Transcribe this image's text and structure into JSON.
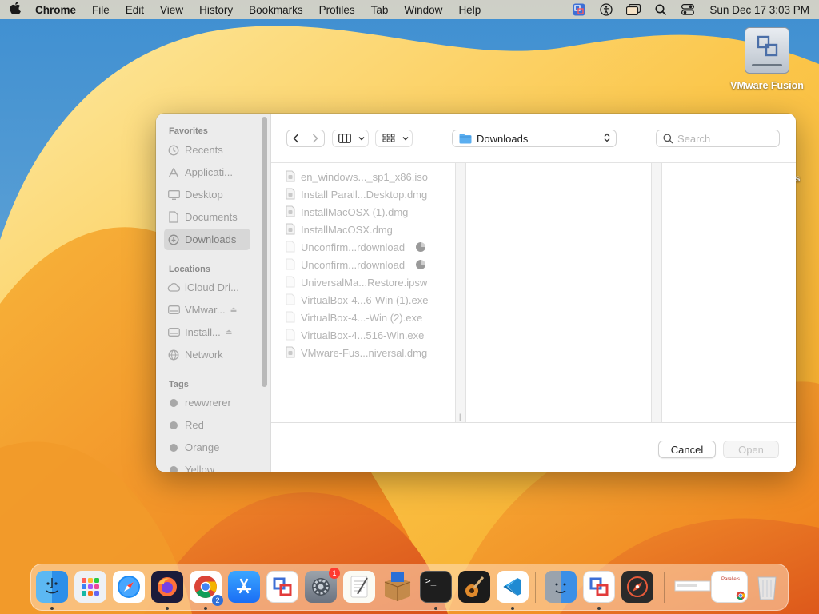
{
  "menubar": {
    "app_name": "Chrome",
    "menus": [
      "File",
      "Edit",
      "View",
      "History",
      "Bookmarks",
      "Profiles",
      "Tab",
      "Window",
      "Help"
    ],
    "status_icons": [
      "vmware-status-icon",
      "accessibility-icon",
      "window-icon",
      "spotlight-search-icon",
      "control-center-icon"
    ],
    "clock": "Sun Dec 17  3:03 PM"
  },
  "desktop": {
    "icon_label": "VMware Fusion",
    "edge_text": "s"
  },
  "dialog": {
    "sidebar": {
      "favorites_heading": "Favorites",
      "favorites": [
        {
          "label": "Recents",
          "icon": "clock-icon"
        },
        {
          "label": "Applicati...",
          "icon": "applications-icon"
        },
        {
          "label": "Desktop",
          "icon": "desktop-icon"
        },
        {
          "label": "Documents",
          "icon": "document-icon"
        },
        {
          "label": "Downloads",
          "icon": "download-icon",
          "selected": true
        }
      ],
      "locations_heading": "Locations",
      "locations": [
        {
          "label": "iCloud Dri...",
          "icon": "cloud-icon"
        },
        {
          "label": "VMwar...",
          "icon": "drive-icon",
          "eject": true
        },
        {
          "label": "Install...",
          "icon": "drive-icon",
          "eject": true
        },
        {
          "label": "Network",
          "icon": "network-icon"
        }
      ],
      "tags_heading": "Tags",
      "tags": [
        {
          "label": "rewwrerer"
        },
        {
          "label": "Red"
        },
        {
          "label": "Orange"
        },
        {
          "label": "Yellow"
        }
      ]
    },
    "toolbar": {
      "back_icon": "chevron-left-icon",
      "forward_icon": "chevron-right-icon",
      "view_icon": "columns-view-icon",
      "group_icon": "grid-group-icon",
      "location": "Downloads",
      "search_placeholder": "Search"
    },
    "files": [
      {
        "name": "en_windows..._sp1_x86.iso",
        "type": "doc"
      },
      {
        "name": "Install Parall...Desktop.dmg",
        "type": "doc"
      },
      {
        "name": "InstallMacOSX (1).dmg",
        "type": "doc"
      },
      {
        "name": "InstallMacOSX.dmg",
        "type": "doc"
      },
      {
        "name": "Unconfirm...rdownload",
        "type": "blank",
        "progress": true
      },
      {
        "name": "Unconfirm...rdownload",
        "type": "blank",
        "progress": true
      },
      {
        "name": "UniversalMa...Restore.ipsw",
        "type": "blank"
      },
      {
        "name": "VirtualBox-4...6-Win (1).exe",
        "type": "blank"
      },
      {
        "name": "VirtualBox-4...-Win (2).exe",
        "type": "blank"
      },
      {
        "name": "VirtualBox-4...516-Win.exe",
        "type": "blank"
      },
      {
        "name": "VMware-Fus...niversal.dmg",
        "type": "doc"
      }
    ],
    "column_grip": "||",
    "buttons": {
      "cancel": "Cancel",
      "open": "Open"
    }
  },
  "dock": {
    "apps": [
      {
        "name": "finder",
        "icon": "finder-icon",
        "running": true
      },
      {
        "name": "launchpad",
        "icon": "launchpad-icon"
      },
      {
        "name": "safari",
        "icon": "safari-icon"
      },
      {
        "name": "firefox",
        "icon": "firefox-icon",
        "running": true
      },
      {
        "name": "chrome",
        "icon": "chrome-icon",
        "running": true,
        "badge": "2"
      },
      {
        "name": "app-store",
        "icon": "app-store-icon"
      },
      {
        "name": "vmware-fusion",
        "icon": "vmware-fusion-icon"
      },
      {
        "name": "system-settings",
        "icon": "settings-gear-icon",
        "badge": "1"
      },
      {
        "name": "textedit",
        "icon": "textedit-icon"
      },
      {
        "name": "installer",
        "icon": "installer-box-icon"
      },
      {
        "name": "terminal",
        "icon": "terminal-icon",
        "running": true
      },
      {
        "name": "instruments",
        "icon": "guitar-icon"
      },
      {
        "name": "vscode",
        "icon": "vscode-icon",
        "running": true
      },
      {
        "name": "migration-assistant",
        "icon": "migration-assistant-icon"
      },
      {
        "name": "vmware-fusion-2",
        "icon": "vmware-fusion-icon",
        "running": true
      },
      {
        "name": "disk-utility",
        "icon": "compass-icon"
      },
      {
        "name": "downloads-stack",
        "icon": "downloads-stack-icon"
      },
      {
        "name": "trash",
        "icon": "trash-icon"
      }
    ],
    "terminal_glyph": ">_",
    "stack_preview_text": "Parallels"
  }
}
